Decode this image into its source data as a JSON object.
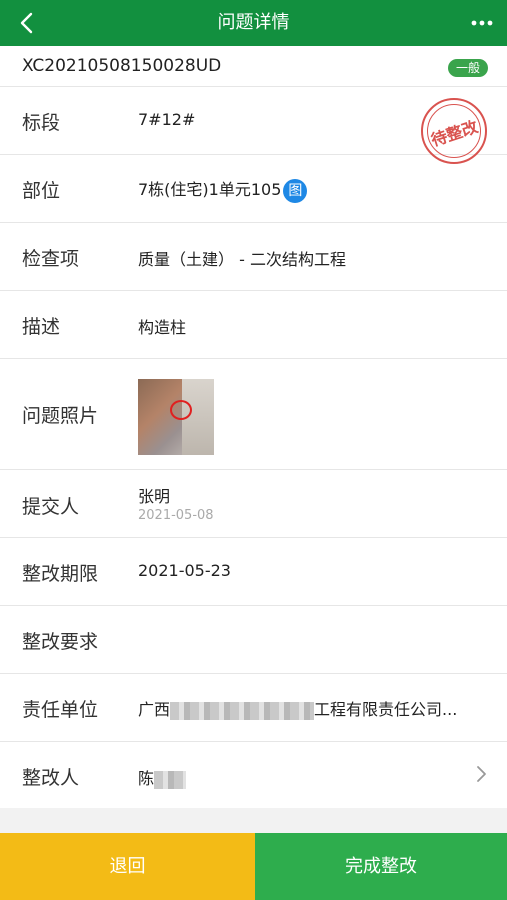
{
  "header": {
    "title": "问题详情",
    "back_icon": "back-arrow-icon",
    "more_icon": "more-dots-icon",
    "color": "#12903f"
  },
  "issue": {
    "code": "XC20210508150028UD",
    "severity_badge": "一般",
    "status_stamp": "待整改"
  },
  "fields": {
    "section": {
      "label": "标段",
      "value": "7#12#"
    },
    "location": {
      "label": "部位",
      "value": "7栋(住宅)1单元105",
      "drawing_badge": "图"
    },
    "check_item": {
      "label": "检查项",
      "value": "质量（土建） - 二次结构工程"
    },
    "description": {
      "label": "描述",
      "value": "构造柱"
    },
    "photos": {
      "label": "问题照片"
    },
    "submitter": {
      "label": "提交人",
      "name": "张明",
      "date": "2021-05-08"
    },
    "deadline": {
      "label": "整改期限",
      "value": "2021-05-23"
    },
    "requirement": {
      "label": "整改要求",
      "value": ""
    },
    "responsible_unit": {
      "label": "责任单位",
      "prefix": "广西",
      "suffix": "工程有限责任公司..."
    },
    "rectifier": {
      "label": "整改人",
      "value": "陈"
    }
  },
  "footer": {
    "back_label": "退回",
    "complete_label": "完成整改",
    "back_color": "#f3bb16",
    "complete_color": "#2ead4d"
  }
}
